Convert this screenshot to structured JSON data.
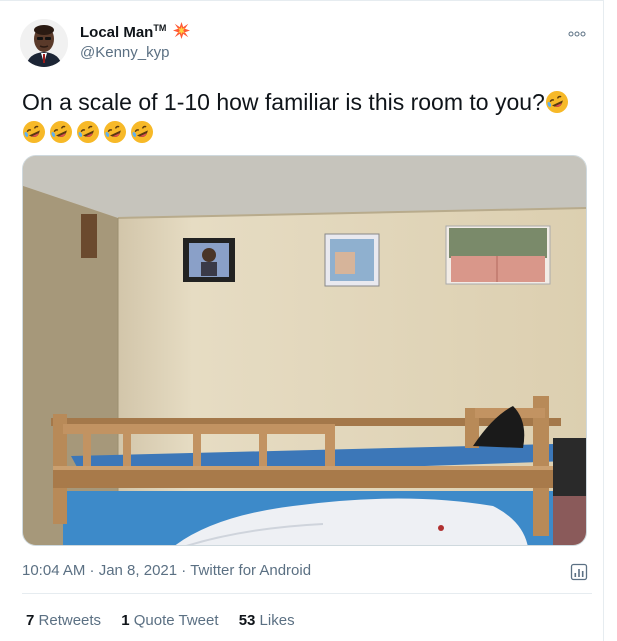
{
  "tweet": {
    "author_name": "Local Man",
    "trademark": "TM",
    "handle": "@Kenny_kyp",
    "text": "On a scale of 1-10 how familiar is this room to you?",
    "emoji_name": "rolling-on-floor-laughing",
    "emoji_count": 6,
    "timestamp": "10:04 AM · Jan 8, 2021",
    "separator": "·",
    "source": "Twitter for Android",
    "retweets_count": "7",
    "retweets_label": "Retweets",
    "quotes_count": "1",
    "quotes_label": "Quote Tweet",
    "likes_count": "53",
    "likes_label": "Likes"
  },
  "icons": {
    "more": "more-dots-icon",
    "analytics": "analytics-icon",
    "badge": "explosion-icon"
  },
  "colors": {
    "text": "#0f1419",
    "secondary": "#5b7083",
    "border": "#e6ecf0",
    "emoji": "#f7b928"
  }
}
